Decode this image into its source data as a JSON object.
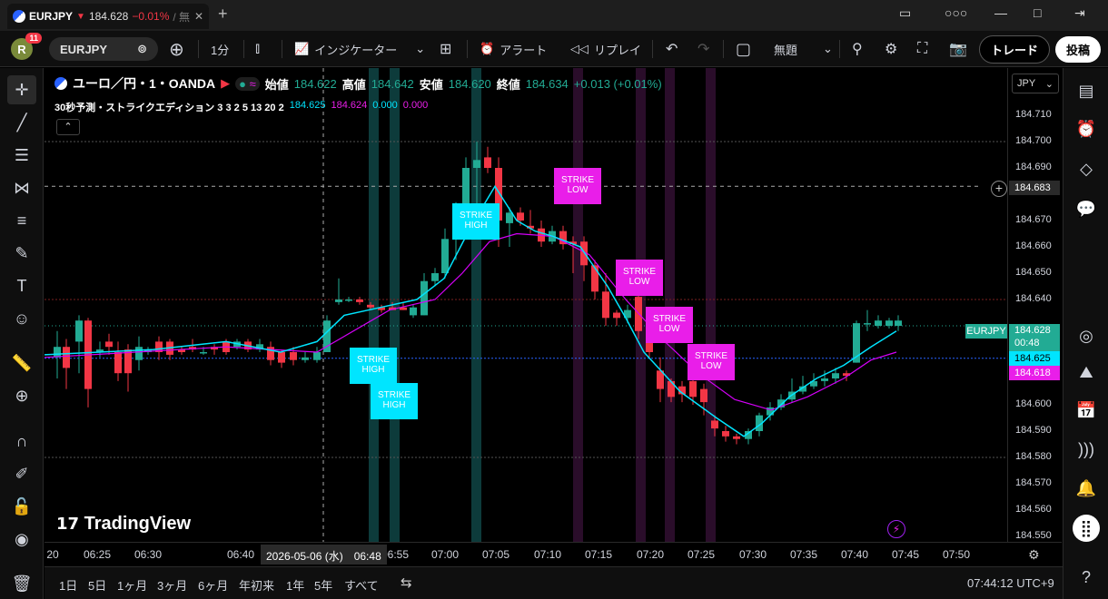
{
  "tab": {
    "symbol": "EURJPY",
    "arrow": "▼",
    "price": "184.628",
    "change": "−0.01%",
    "more": "/ 無"
  },
  "toolbar": {
    "avatar_letter": "R",
    "notif_count": "11",
    "symbol": "EURJPY",
    "interval": "1分",
    "indicators": "インジケーター",
    "alert": "アラート",
    "replay": "リプレイ",
    "layout_name": "無題",
    "trade": "トレード",
    "publish": "投稿"
  },
  "legend": {
    "title": "ユーロ／円・1・OANDA",
    "open_label": "始値",
    "open": "184.622",
    "high_label": "高値",
    "high": "184.642",
    "low_label": "安値",
    "low": "184.620",
    "close_label": "終値",
    "close": "184.634",
    "change": "+0.013 (+0.01%)"
  },
  "indicator": {
    "name": "30秒予測・ストライクエディション 3 3 2 5 13 20 2",
    "v1": "184.625",
    "v2": "184.624",
    "v3": "0.000",
    "v4": "0.000"
  },
  "currency": "JPY",
  "price_axis": {
    "ticks": [
      "184.710",
      "184.700",
      "184.690",
      "184.670",
      "184.660",
      "184.650",
      "184.640",
      "184.600",
      "184.590",
      "184.580",
      "184.570",
      "184.560",
      "184.550"
    ],
    "crosshair_price": "184.683",
    "last_symbol": "EURJPY",
    "last_price": "184.628",
    "countdown": "00:48",
    "ma_fast": "184.625",
    "ma_slow": "184.618"
  },
  "time_axis": {
    "ticks": [
      "20",
      "06:25",
      "06:30",
      "06:40",
      "06:55",
      "07:00",
      "07:05",
      "07:10",
      "07:15",
      "07:20",
      "07:25",
      "07:30",
      "07:35",
      "07:40",
      "07:45",
      "07:50"
    ],
    "crosshair_label": "2026-05-06 (水)　06:48"
  },
  "signals": [
    {
      "type": "HIGH",
      "line1": "STRIKE",
      "line2": "HIGH"
    },
    {
      "type": "HIGH",
      "line1": "STRIKE",
      "line2": "HIGH"
    },
    {
      "type": "HIGH",
      "line1": "STRIKE",
      "line2": "HIGH"
    },
    {
      "type": "LOW",
      "line1": "STRIKE",
      "line2": "LOW"
    },
    {
      "type": "LOW",
      "line1": "STRIKE",
      "line2": "LOW"
    },
    {
      "type": "LOW",
      "line1": "STRIKE",
      "line2": "LOW"
    },
    {
      "type": "LOW",
      "line1": "STRIKE",
      "line2": "LOW"
    }
  ],
  "watermark": "TradingView",
  "ranges": [
    "1日",
    "5日",
    "1ヶ月",
    "3ヶ月",
    "6ヶ月",
    "年初来",
    "1年",
    "5年",
    "すべて"
  ],
  "clock": "07:44:12 UTC+9",
  "colors": {
    "up": "#22ab94",
    "down": "#f23645",
    "ma_fast": "#00e5ff",
    "ma_slow": "#d500f9",
    "signal_high": "#00e5ff",
    "signal_low": "#e91ee9"
  }
}
